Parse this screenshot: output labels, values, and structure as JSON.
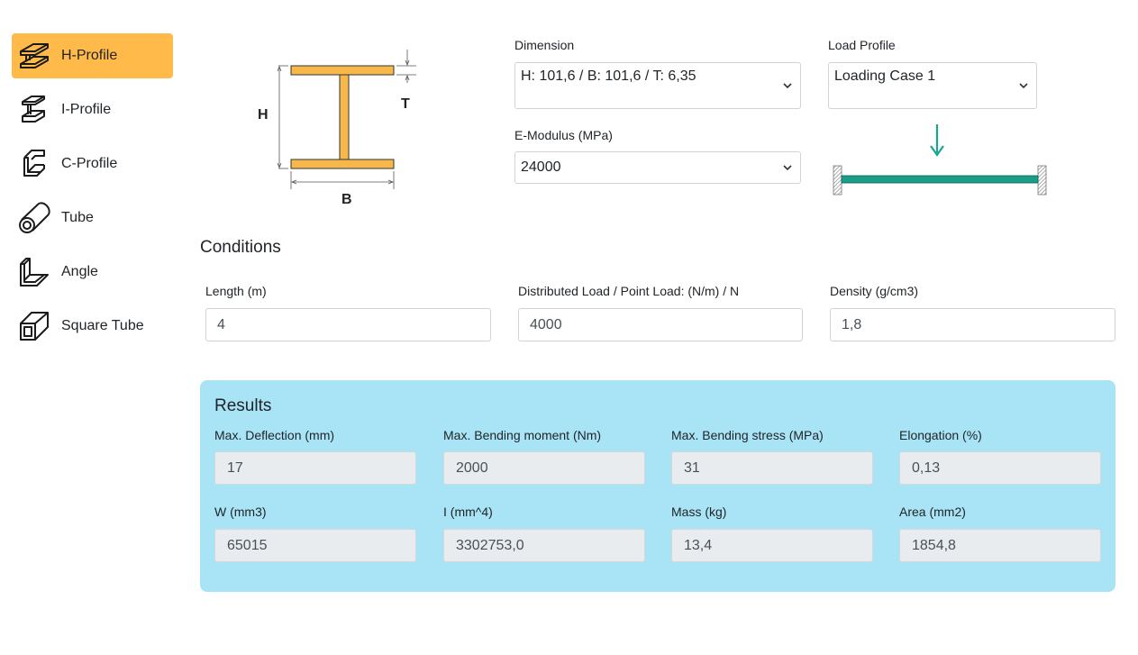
{
  "sidebar": {
    "items": [
      {
        "label": "H-Profile",
        "icon": "h-profile-icon",
        "active": true
      },
      {
        "label": "I-Profile",
        "icon": "i-profile-icon",
        "active": false
      },
      {
        "label": "C-Profile",
        "icon": "c-profile-icon",
        "active": false
      },
      {
        "label": "Tube",
        "icon": "tube-icon",
        "active": false
      },
      {
        "label": "Angle",
        "icon": "angle-icon",
        "active": false
      },
      {
        "label": "Square Tube",
        "icon": "square-tube-icon",
        "active": false
      }
    ]
  },
  "diagram": {
    "h_label": "H",
    "t_label": "T",
    "b_label": "B"
  },
  "dimension": {
    "label": "Dimension",
    "value": "H: 101,6 / B: 101,6 / T: 6,35"
  },
  "load_profile": {
    "label": "Load Profile",
    "value": "Loading Case 1"
  },
  "e_modulus": {
    "label": "E-Modulus (MPa)",
    "value": "24000"
  },
  "conditions": {
    "title": "Conditions",
    "length": {
      "label": "Length (m)",
      "value": "4"
    },
    "load": {
      "label": "Distributed Load / Point Load: (N/m) / N",
      "value": "4000"
    },
    "density": {
      "label": "Density (g/cm3)",
      "value": "1,8"
    }
  },
  "results": {
    "title": "Results",
    "row1": [
      {
        "label": "Max. Deflection (mm)",
        "value": "17"
      },
      {
        "label": "Max. Bending moment (Nm)",
        "value": "2000"
      },
      {
        "label": "Max. Bending stress (MPa)",
        "value": "31"
      },
      {
        "label": "Elongation (%)",
        "value": "0,13"
      }
    ],
    "row2": [
      {
        "label": "W (mm3)",
        "value": "65015"
      },
      {
        "label": "I (mm^4)",
        "value": "3302753,0"
      },
      {
        "label": "Mass (kg)",
        "value": "13,4"
      },
      {
        "label": "Area (mm2)",
        "value": "1854,8"
      }
    ]
  },
  "colors": {
    "accent": "#ffba4a",
    "profile_fill": "#f7b84b",
    "beam": "#1a9e8a",
    "arrow": "#1aa88c",
    "results_bg": "#a8e4f5"
  }
}
